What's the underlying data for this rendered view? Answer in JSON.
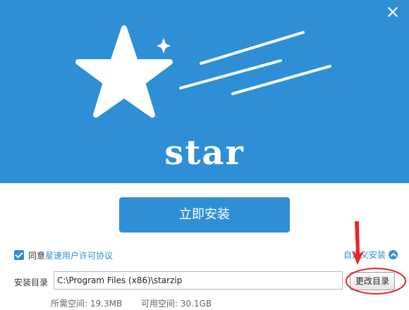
{
  "window": {
    "close_icon": "close-icon",
    "brand_name": "star",
    "colors": {
      "primary": "#2f8fd6",
      "annotation": "#e62828"
    }
  },
  "install": {
    "button_label": "立即安装"
  },
  "agreement": {
    "checked": true,
    "prefix": "同意",
    "link_text": "星速用户许可协议"
  },
  "custom_install": {
    "label": "自定义安装",
    "icon": "chevron-up-icon"
  },
  "directory": {
    "label": "安装目录",
    "value": "C:\\Program Files (x86)\\starzip",
    "change_button": "更改目录"
  },
  "space": {
    "required_label": "所需空间:",
    "required_value": "19.3MB",
    "free_label": "可用空间:",
    "free_value": "30.1GB"
  }
}
